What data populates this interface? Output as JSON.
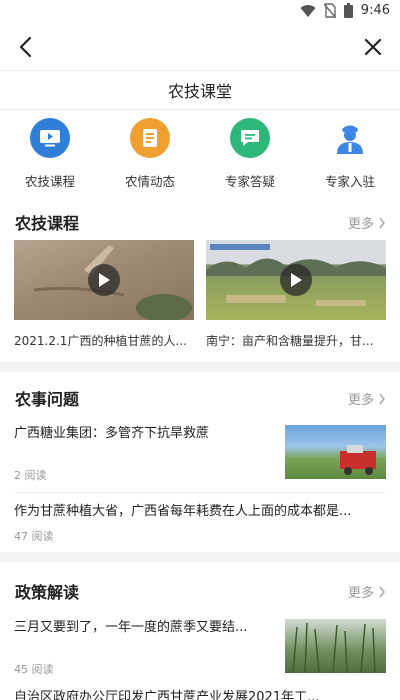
{
  "status_bar": {
    "time": "9:46"
  },
  "header": {
    "title": "农技课堂"
  },
  "categories": [
    {
      "label": "农技课程",
      "icon": "video-icon",
      "color": "#2f7fd8"
    },
    {
      "label": "农情动态",
      "icon": "document-icon",
      "color": "#f0a030"
    },
    {
      "label": "专家答疑",
      "icon": "chat-icon",
      "color": "#2db87a"
    },
    {
      "label": "专家入驻",
      "icon": "expert-icon",
      "color": "#3f85e6"
    }
  ],
  "courses": {
    "title": "农技课程",
    "more": "更多",
    "items": [
      {
        "caption": "2021.2.1广西的种植甘蔗的人..."
      },
      {
        "caption": "南宁：亩产和含糖量提升，甘..."
      }
    ]
  },
  "issues": {
    "title": "农事问题",
    "more": "更多",
    "items": [
      {
        "title": "广西糖业集团：多管齐下抗旱救蔗",
        "reads": "2 阅读"
      },
      {
        "title": "作为甘蔗种植大省，广西省每年耗费在人上面的成本都是...",
        "reads": "47 阅读"
      }
    ]
  },
  "policy": {
    "title": "政策解读",
    "more": "更多",
    "items": [
      {
        "title": "三月又要到了，一年一度的蔗季又要结...",
        "reads": "45 阅读"
      },
      {
        "title": "自治区政府办公厅印发广西甘蔗产业发展2021年工..."
      }
    ]
  }
}
